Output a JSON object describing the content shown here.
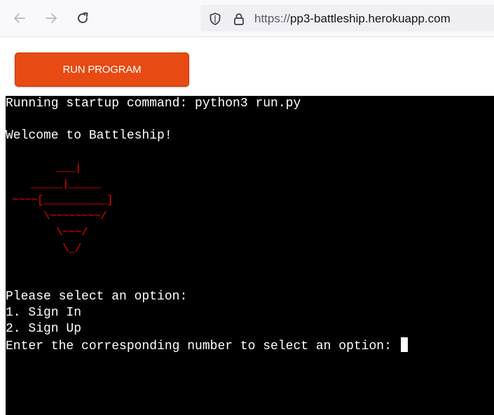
{
  "browser": {
    "url_scheme": "https://",
    "url_host": "pp3-battleship.herokuapp.com",
    "icons": [
      "back-arrow-icon",
      "forward-arrow-icon",
      "reload-icon",
      "shield-icon",
      "lock-icon"
    ]
  },
  "page": {
    "run_button_label": "RUN PROGRAM",
    "colors": {
      "run_button": "#e84a13",
      "terminal_bg": "#000000",
      "terminal_text": "#ffffff",
      "ascii_art": "#e10600"
    }
  },
  "terminal": {
    "startup_line": "Running startup command: python3 run.py",
    "welcome_line": "Welcome to Battleship!",
    "ascii_art": "        ___|\n    _____|_____\n ~~~~[__________]\n      \\~~~~~~~~/\n        \\~~~/\n         \\_/",
    "menu_prompt": "Please select an option:",
    "option_1": "1. Sign In",
    "option_2": "2. Sign Up",
    "input_prompt": "Enter the corresponding number to select an option: "
  }
}
